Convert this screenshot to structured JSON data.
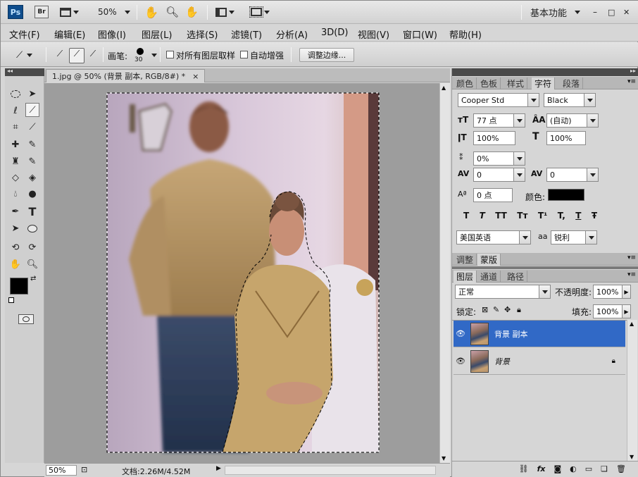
{
  "appbar": {
    "ps_logo": "Ps",
    "br_logo": "Br",
    "zoom": "50%",
    "workspace": "基本功能",
    "window_buttons": [
      "–",
      "□",
      "✕"
    ]
  },
  "menu": {
    "items": [
      "文件(F)",
      "编辑(E)",
      "图像(I)",
      "图层(L)",
      "选择(S)",
      "滤镜(T)",
      "分析(A)",
      "3D(D)",
      "视图(V)",
      "窗口(W)",
      "帮助(H)"
    ]
  },
  "options": {
    "brush_label": "画笔:",
    "brush_size": "30",
    "sample_all_label": "对所有图层取样",
    "auto_enhance_label": "自动增强",
    "refine_edge_label": "调整边缘..."
  },
  "document": {
    "tab_title": "1.jpg @ 50% (背景 副本, RGB/8#) *",
    "close": "×"
  },
  "status": {
    "zoom": "50%",
    "doc_info": "文档:2.26M/4.52M"
  },
  "char_panel": {
    "tabs": [
      "颜色",
      "色板",
      "样式",
      "字符",
      "段落"
    ],
    "active_tab": "字符",
    "font_family": "Cooper Std",
    "font_style": "Black",
    "font_size": "77 点",
    "leading": "(自动)",
    "vertical_scale": "100%",
    "horizontal_scale": "100%",
    "tsume": "0%",
    "kerning": "0",
    "tracking": "0",
    "baseline": "0 点",
    "color_label": "颜色:",
    "text_color": "#000000",
    "style_buttons": [
      "T",
      "T",
      "TT",
      "Tт",
      "T¹",
      "T,",
      "T",
      "Ŧ"
    ],
    "language": "美国英语",
    "aa_icon": "aa",
    "antialias": "锐利"
  },
  "adjust_panel": {
    "tabs": [
      "调整",
      "蒙版"
    ],
    "active_tab": "蒙版"
  },
  "layers_panel": {
    "tabs": [
      "图层",
      "通道",
      "路径"
    ],
    "active_tab": "图层",
    "blend_mode": "正常",
    "opacity_label": "不透明度:",
    "opacity": "100%",
    "lock_label": "锁定:",
    "fill_label": "填充:",
    "fill": "100%",
    "layers": [
      {
        "name": "背景 副本",
        "selected": true
      },
      {
        "name": "背景",
        "selected": false
      }
    ]
  },
  "colors": {
    "accent": "#3169c6",
    "canvas_bg": "#9d9d9d"
  }
}
